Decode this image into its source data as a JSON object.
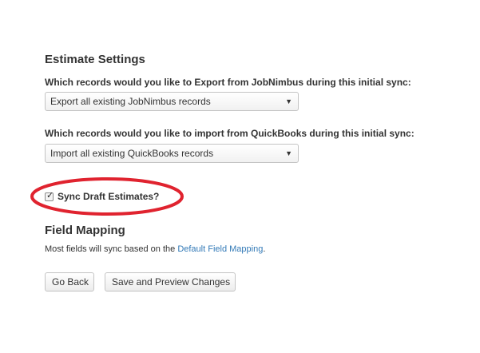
{
  "estimate_settings": {
    "title": "Estimate Settings",
    "export_question": "Which records would you like to Export from JobNimbus during this initial sync:",
    "export_selected": "Export all existing JobNimbus records",
    "import_question": "Which records would you like to import from QuickBooks during this initial sync:",
    "import_selected": "Import all existing QuickBooks records",
    "sync_draft_label": "Sync Draft Estimates?",
    "sync_draft_checked": true,
    "highlight_color": "#e0232f"
  },
  "field_mapping": {
    "title": "Field Mapping",
    "help_prefix": "Most fields will sync based on the ",
    "help_link": "Default Field Mapping",
    "help_suffix": "."
  },
  "actions": {
    "back_label": "Go Back",
    "save_label": "Save and Preview Changes"
  },
  "icons": {
    "dropdown": "chevron-down-icon",
    "checkmark": "checkmark-icon"
  },
  "colors": {
    "link": "#337ab7",
    "text": "#333333"
  }
}
